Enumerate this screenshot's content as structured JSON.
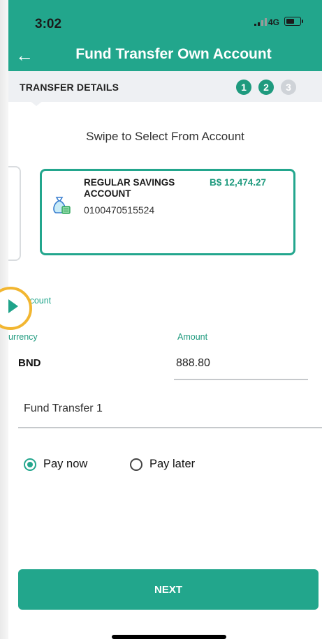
{
  "status_bar": {
    "time": "3:02",
    "network": "4G"
  },
  "header": {
    "title": "Fund Transfer Own Account",
    "back_icon": "arrow-left-icon"
  },
  "steps": {
    "label": "TRANSFER DETAILS",
    "items": [
      "1",
      "2",
      "3"
    ],
    "current": 2
  },
  "swipe_hint": "Swipe to Select From Account",
  "from_account": {
    "name": "REGULAR SAVINGS ACCOUNT",
    "balance": "B$ 12,474.27",
    "number": "0100470515524",
    "icon": "money-bag-icon"
  },
  "to_account_label": "To Account",
  "currency": {
    "label": "urrency",
    "value": "BND"
  },
  "amount": {
    "label": "Amount",
    "value": "888.80"
  },
  "remark": {
    "value": "Fund Transfer 1"
  },
  "payment_options": [
    {
      "label": "Pay now",
      "selected": true
    },
    {
      "label": "Pay later",
      "selected": false
    }
  ],
  "next_button": "NEXT",
  "colors": {
    "accent": "#22a68c",
    "highlight_ring": "#f2b631"
  }
}
